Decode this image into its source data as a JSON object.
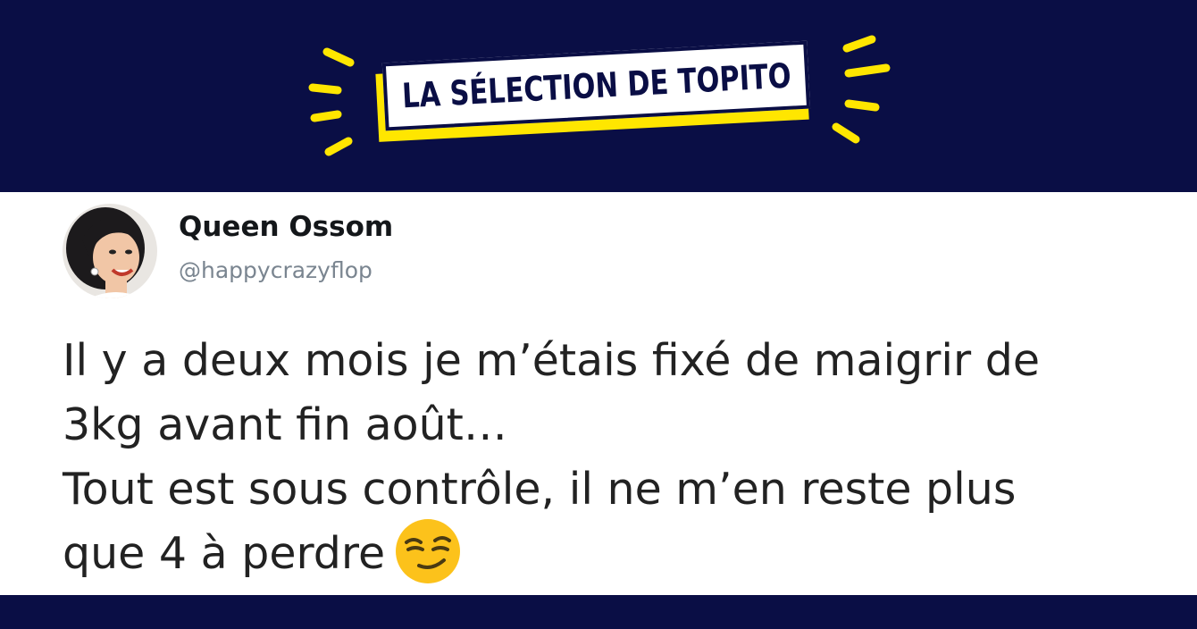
{
  "banner": {
    "badge_text": "LA SÉLECTION DE TOPITO",
    "colors": {
      "background": "#0a0e45",
      "accent": "#ffe600"
    }
  },
  "tweet": {
    "display_name": "Queen Ossom",
    "handle": "@happycrazyflop",
    "lines": [
      "Il y a deux mois je m’étais fixé de maigrir de",
      "3kg avant fin août…",
      "Tout est sous contrôle, il ne m’en reste plus",
      "que 4 à perdre"
    ],
    "emoji": "smirking-face-icon"
  }
}
